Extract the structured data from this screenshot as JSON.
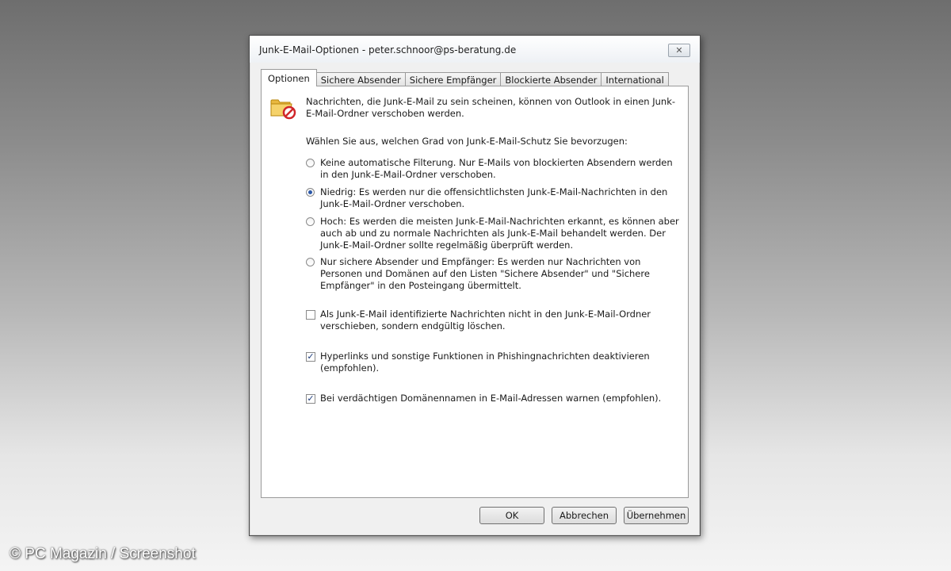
{
  "window": {
    "title": "Junk-E-Mail-Optionen - peter.schnoor@ps-beratung.de",
    "close_glyph": "✕"
  },
  "tabs": [
    {
      "label": "Optionen",
      "active": true
    },
    {
      "label": "Sichere Absender",
      "active": false
    },
    {
      "label": "Sichere Empfänger",
      "active": false
    },
    {
      "label": "Blockierte Absender",
      "active": false
    },
    {
      "label": "International",
      "active": false
    }
  ],
  "intro": {
    "icon": "junk-folder-icon",
    "text": "Nachrichten, die Junk-E-Mail zu sein scheinen, können von Outlook in einen Junk-E-Mail-Ordner verschoben werden."
  },
  "prompt": "Wählen Sie aus, welchen Grad von Junk-E-Mail-Schutz Sie bevorzugen:",
  "protection_levels": [
    {
      "label": "Keine automatische Filterung. Nur E-Mails von blockierten Absendern werden in den Junk-E-Mail-Ordner verschoben.",
      "checked": false
    },
    {
      "label": "Niedrig: Es werden nur die offensichtlichsten Junk-E-Mail-Nachrichten in den Junk-E-Mail-Ordner verschoben.",
      "checked": true
    },
    {
      "label": "Hoch: Es werden die meisten Junk-E-Mail-Nachrichten erkannt, es können aber auch ab und zu normale Nachrichten als Junk-E-Mail behandelt werden. Der Junk-E-Mail-Ordner sollte regelmäßig überprüft werden.",
      "checked": false
    },
    {
      "label": "Nur sichere Absender und Empfänger: Es werden nur Nachrichten von Personen und Domänen auf den Listen \"Sichere Absender\" und \"Sichere Empfänger\" in den Posteingang übermittelt.",
      "checked": false
    }
  ],
  "checkboxes": [
    {
      "label": "Als Junk-E-Mail identifizierte Nachrichten nicht in den Junk-E-Mail-Ordner verschieben, sondern endgültig löschen.",
      "checked": false
    },
    {
      "label": "Hyperlinks und sonstige Funktionen in Phishingnachrichten deaktivieren (empfohlen).",
      "checked": true
    },
    {
      "label": "Bei verdächtigen Domänennamen in E-Mail-Adressen warnen (empfohlen).",
      "checked": true
    }
  ],
  "check_glyph": "✓",
  "buttons": {
    "ok": "OK",
    "cancel": "Abbrechen",
    "apply": "Übernehmen"
  },
  "watermark": "© PC Magazin / Screenshot"
}
